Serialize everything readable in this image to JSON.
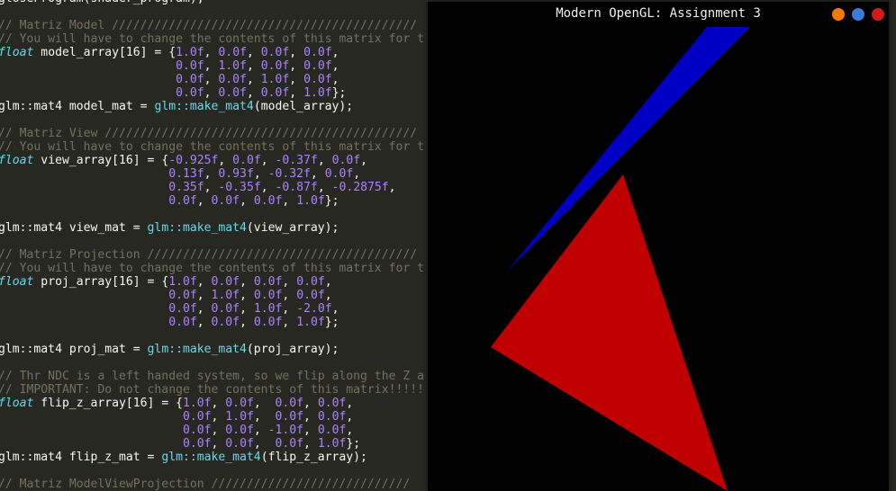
{
  "editor": {
    "lines": [
      [
        {
          "t": "plain",
          "s": "glUseProgram(shader_program);"
        }
      ],
      [],
      [
        {
          "t": "comment",
          "s": "// Matriz Model ///////////////////////////////////////////"
        }
      ],
      [
        {
          "t": "comment",
          "s": "// You will have to change the contents of this matrix for t"
        }
      ],
      [
        {
          "t": "kw",
          "s": "float"
        },
        {
          "t": "plain",
          "s": " model_array[16] = {"
        },
        {
          "t": "num",
          "s": "1.0f"
        },
        {
          "t": "plain",
          "s": ", "
        },
        {
          "t": "num",
          "s": "0.0f"
        },
        {
          "t": "plain",
          "s": ", "
        },
        {
          "t": "num",
          "s": "0.0f"
        },
        {
          "t": "plain",
          "s": ", "
        },
        {
          "t": "num",
          "s": "0.0f"
        },
        {
          "t": "plain",
          "s": ","
        }
      ],
      [
        {
          "t": "plain",
          "s": "                         "
        },
        {
          "t": "num",
          "s": "0.0f"
        },
        {
          "t": "plain",
          "s": ", "
        },
        {
          "t": "num",
          "s": "1.0f"
        },
        {
          "t": "plain",
          "s": ", "
        },
        {
          "t": "num",
          "s": "0.0f"
        },
        {
          "t": "plain",
          "s": ", "
        },
        {
          "t": "num",
          "s": "0.0f"
        },
        {
          "t": "plain",
          "s": ","
        }
      ],
      [
        {
          "t": "plain",
          "s": "                         "
        },
        {
          "t": "num",
          "s": "0.0f"
        },
        {
          "t": "plain",
          "s": ", "
        },
        {
          "t": "num",
          "s": "0.0f"
        },
        {
          "t": "plain",
          "s": ", "
        },
        {
          "t": "num",
          "s": "1.0f"
        },
        {
          "t": "plain",
          "s": ", "
        },
        {
          "t": "num",
          "s": "0.0f"
        },
        {
          "t": "plain",
          "s": ","
        }
      ],
      [
        {
          "t": "plain",
          "s": "                         "
        },
        {
          "t": "num",
          "s": "0.0f"
        },
        {
          "t": "plain",
          "s": ", "
        },
        {
          "t": "num",
          "s": "0.0f"
        },
        {
          "t": "plain",
          "s": ", "
        },
        {
          "t": "num",
          "s": "0.0f"
        },
        {
          "t": "plain",
          "s": ", "
        },
        {
          "t": "num",
          "s": "1.0f"
        },
        {
          "t": "plain",
          "s": "};"
        }
      ],
      [
        {
          "t": "plain",
          "s": "glm::mat4 model_mat = "
        },
        {
          "t": "fn",
          "s": "glm::make_mat4"
        },
        {
          "t": "plain",
          "s": "(model_array);"
        }
      ],
      [],
      [
        {
          "t": "comment",
          "s": "// Matriz View ////////////////////////////////////////////"
        }
      ],
      [
        {
          "t": "comment",
          "s": "// You will have to change the contents of this matrix for t"
        }
      ],
      [
        {
          "t": "kw",
          "s": "float"
        },
        {
          "t": "plain",
          "s": " view_array[16] = {"
        },
        {
          "t": "num",
          "s": "-0.925f"
        },
        {
          "t": "plain",
          "s": ", "
        },
        {
          "t": "num",
          "s": "0.0f"
        },
        {
          "t": "plain",
          "s": ", "
        },
        {
          "t": "num",
          "s": "-0.37f"
        },
        {
          "t": "plain",
          "s": ", "
        },
        {
          "t": "num",
          "s": "0.0f"
        },
        {
          "t": "plain",
          "s": ","
        }
      ],
      [
        {
          "t": "plain",
          "s": "                        "
        },
        {
          "t": "num",
          "s": "0.13f"
        },
        {
          "t": "plain",
          "s": ", "
        },
        {
          "t": "num",
          "s": "0.93f"
        },
        {
          "t": "plain",
          "s": ", "
        },
        {
          "t": "num",
          "s": "-0.32f"
        },
        {
          "t": "plain",
          "s": ", "
        },
        {
          "t": "num",
          "s": "0.0f"
        },
        {
          "t": "plain",
          "s": ","
        }
      ],
      [
        {
          "t": "plain",
          "s": "                        "
        },
        {
          "t": "num",
          "s": "0.35f"
        },
        {
          "t": "plain",
          "s": ", "
        },
        {
          "t": "num",
          "s": "-0.35f"
        },
        {
          "t": "plain",
          "s": ", "
        },
        {
          "t": "num",
          "s": "-0.87f"
        },
        {
          "t": "plain",
          "s": ", "
        },
        {
          "t": "num",
          "s": "-0.2875f"
        },
        {
          "t": "plain",
          "s": ","
        }
      ],
      [
        {
          "t": "plain",
          "s": "                        "
        },
        {
          "t": "num",
          "s": "0.0f"
        },
        {
          "t": "plain",
          "s": ", "
        },
        {
          "t": "num",
          "s": "0.0f"
        },
        {
          "t": "plain",
          "s": ", "
        },
        {
          "t": "num",
          "s": "0.0f"
        },
        {
          "t": "plain",
          "s": ", "
        },
        {
          "t": "num",
          "s": "1.0f"
        },
        {
          "t": "plain",
          "s": "};"
        }
      ],
      [],
      [
        {
          "t": "plain",
          "s": "glm::mat4 view_mat = "
        },
        {
          "t": "fn",
          "s": "glm::make_mat4"
        },
        {
          "t": "plain",
          "s": "(view_array);"
        }
      ],
      [],
      [
        {
          "t": "comment",
          "s": "// Matriz Projection //////////////////////////////////////"
        }
      ],
      [
        {
          "t": "comment",
          "s": "// You will have to change the contents of this matrix for t"
        }
      ],
      [
        {
          "t": "kw",
          "s": "float"
        },
        {
          "t": "plain",
          "s": " proj_array[16] = {"
        },
        {
          "t": "num",
          "s": "1.0f"
        },
        {
          "t": "plain",
          "s": ", "
        },
        {
          "t": "num",
          "s": "0.0f"
        },
        {
          "t": "plain",
          "s": ", "
        },
        {
          "t": "num",
          "s": "0.0f"
        },
        {
          "t": "plain",
          "s": ", "
        },
        {
          "t": "num",
          "s": "0.0f"
        },
        {
          "t": "plain",
          "s": ","
        }
      ],
      [
        {
          "t": "plain",
          "s": "                        "
        },
        {
          "t": "num",
          "s": "0.0f"
        },
        {
          "t": "plain",
          "s": ", "
        },
        {
          "t": "num",
          "s": "1.0f"
        },
        {
          "t": "plain",
          "s": ", "
        },
        {
          "t": "num",
          "s": "0.0f"
        },
        {
          "t": "plain",
          "s": ", "
        },
        {
          "t": "num",
          "s": "0.0f"
        },
        {
          "t": "plain",
          "s": ","
        }
      ],
      [
        {
          "t": "plain",
          "s": "                        "
        },
        {
          "t": "num",
          "s": "0.0f"
        },
        {
          "t": "plain",
          "s": ", "
        },
        {
          "t": "num",
          "s": "0.0f"
        },
        {
          "t": "plain",
          "s": ", "
        },
        {
          "t": "num",
          "s": "1.0f"
        },
        {
          "t": "plain",
          "s": ", "
        },
        {
          "t": "num",
          "s": "-2.0f"
        },
        {
          "t": "plain",
          "s": ","
        }
      ],
      [
        {
          "t": "plain",
          "s": "                        "
        },
        {
          "t": "num",
          "s": "0.0f"
        },
        {
          "t": "plain",
          "s": ", "
        },
        {
          "t": "num",
          "s": "0.0f"
        },
        {
          "t": "plain",
          "s": ", "
        },
        {
          "t": "num",
          "s": "0.0f"
        },
        {
          "t": "plain",
          "s": ", "
        },
        {
          "t": "num",
          "s": "1.0f"
        },
        {
          "t": "plain",
          "s": "};"
        }
      ],
      [],
      [
        {
          "t": "plain",
          "s": "glm::mat4 proj_mat = "
        },
        {
          "t": "fn",
          "s": "glm::make_mat4"
        },
        {
          "t": "plain",
          "s": "(proj_array);"
        }
      ],
      [],
      [
        {
          "t": "comment",
          "s": "// Thr NDC is a left handed system, so we flip along the Z a"
        }
      ],
      [
        {
          "t": "comment",
          "s": "// IMPORTANT: Do not change the contents of this matrix!!!!!"
        }
      ],
      [
        {
          "t": "kw",
          "s": "float"
        },
        {
          "t": "plain",
          "s": " flip_z_array[16] = {"
        },
        {
          "t": "num",
          "s": "1.0f"
        },
        {
          "t": "plain",
          "s": ", "
        },
        {
          "t": "num",
          "s": "0.0f"
        },
        {
          "t": "plain",
          "s": ",  "
        },
        {
          "t": "num",
          "s": "0.0f"
        },
        {
          "t": "plain",
          "s": ", "
        },
        {
          "t": "num",
          "s": "0.0f"
        },
        {
          "t": "plain",
          "s": ","
        }
      ],
      [
        {
          "t": "plain",
          "s": "                          "
        },
        {
          "t": "num",
          "s": "0.0f"
        },
        {
          "t": "plain",
          "s": ", "
        },
        {
          "t": "num",
          "s": "1.0f"
        },
        {
          "t": "plain",
          "s": ",  "
        },
        {
          "t": "num",
          "s": "0.0f"
        },
        {
          "t": "plain",
          "s": ", "
        },
        {
          "t": "num",
          "s": "0.0f"
        },
        {
          "t": "plain",
          "s": ","
        }
      ],
      [
        {
          "t": "plain",
          "s": "                          "
        },
        {
          "t": "num",
          "s": "0.0f"
        },
        {
          "t": "plain",
          "s": ", "
        },
        {
          "t": "num",
          "s": "0.0f"
        },
        {
          "t": "plain",
          "s": ", "
        },
        {
          "t": "num",
          "s": "-1.0f"
        },
        {
          "t": "plain",
          "s": ", "
        },
        {
          "t": "num",
          "s": "0.0f"
        },
        {
          "t": "plain",
          "s": ","
        }
      ],
      [
        {
          "t": "plain",
          "s": "                          "
        },
        {
          "t": "num",
          "s": "0.0f"
        },
        {
          "t": "plain",
          "s": ", "
        },
        {
          "t": "num",
          "s": "0.0f"
        },
        {
          "t": "plain",
          "s": ",  "
        },
        {
          "t": "num",
          "s": "0.0f"
        },
        {
          "t": "plain",
          "s": ", "
        },
        {
          "t": "num",
          "s": "1.0f"
        },
        {
          "t": "plain",
          "s": "};"
        }
      ],
      [
        {
          "t": "plain",
          "s": "glm::mat4 flip_z_mat = "
        },
        {
          "t": "fn",
          "s": "glm::make_mat4"
        },
        {
          "t": "plain",
          "s": "(flip_z_array);"
        }
      ],
      [],
      [
        {
          "t": "comment",
          "s": "// Matriz ModelViewProjection ////////////////////////////"
        }
      ]
    ]
  },
  "window": {
    "title": "Modern OpenGL: Assignment 3",
    "buttons": [
      {
        "name": "minimize",
        "color": "#f57900"
      },
      {
        "name": "maximize",
        "color": "#3d7bd9"
      },
      {
        "name": "close",
        "color": "#d01c1c"
      }
    ]
  },
  "scene": {
    "background": "#000000",
    "shapes": [
      {
        "name": "blue-triangle",
        "color": "#0000c4"
      },
      {
        "name": "red-triangle",
        "color": "#c00000"
      }
    ]
  }
}
